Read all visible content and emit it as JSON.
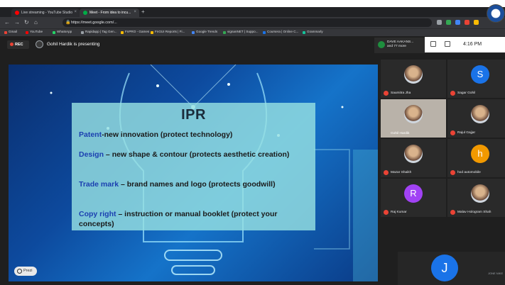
{
  "browser": {
    "tabs": [
      {
        "label": "Live streaming - YouTube Studio",
        "active": false
      },
      {
        "label": "Meet - From idea to incu...",
        "active": true
      }
    ],
    "url": "https://meet.google.com/...",
    "bookmarks": [
      "Gmail",
      "YouTube",
      "WhatsApp",
      "Rapidapp | Tag Gen...",
      "FnPRO - Games",
      "FnGUI Reports | Fi...",
      "Google Trends",
      "vignanNET | Suppo...",
      "Coursera | Online C...",
      "Grammarly"
    ]
  },
  "meet": {
    "rec_label": "REC",
    "presenting_text": "Gohil Hardik is presenting",
    "header_name": "DAVE AAKANS...",
    "header_sub": "and 77 more",
    "time": "4:16 PM",
    "participants": [
      {
        "name": "Saumitra Jha",
        "initial": "",
        "color": "#c79a6b",
        "photo": true
      },
      {
        "name": "Sagar Gohil",
        "initial": "S",
        "color": "#1a73e8",
        "photo": false
      },
      {
        "name": "Gohil Hardik",
        "initial": "",
        "color": "#b9b2a9",
        "video": true
      },
      {
        "name": "Rajul Gajjar",
        "initial": "",
        "color": "#c79a6b",
        "photo": true
      },
      {
        "name": "Mazar Shaikh",
        "initial": "",
        "color": "#c79a6b",
        "photo": true
      },
      {
        "name": "hod automobile",
        "initial": "h",
        "color": "#f29900",
        "photo": false
      },
      {
        "name": "Raj Kumar",
        "initial": "R",
        "color": "#a142f4",
        "photo": false
      },
      {
        "name": "Malav Hologram Shah",
        "initial": "",
        "color": "#c79a6b",
        "photo": true
      }
    ],
    "self_initial": "J",
    "self_label": "JONE NIKE"
  },
  "slide": {
    "title": "IPR",
    "items": [
      {
        "keyword": "Patent",
        "rest": "-new innovation (protect technology)"
      },
      {
        "keyword": "Design",
        "rest": " – new shape & contour (protects aesthetic creation)"
      },
      {
        "keyword": "Trade mark",
        "rest": " – brand names and logo (protects goodwill)"
      },
      {
        "keyword": "Copy right",
        "rest": " – instruction or manual booklet (protect your concepts)"
      }
    ],
    "prezi_label": "Prezi"
  }
}
